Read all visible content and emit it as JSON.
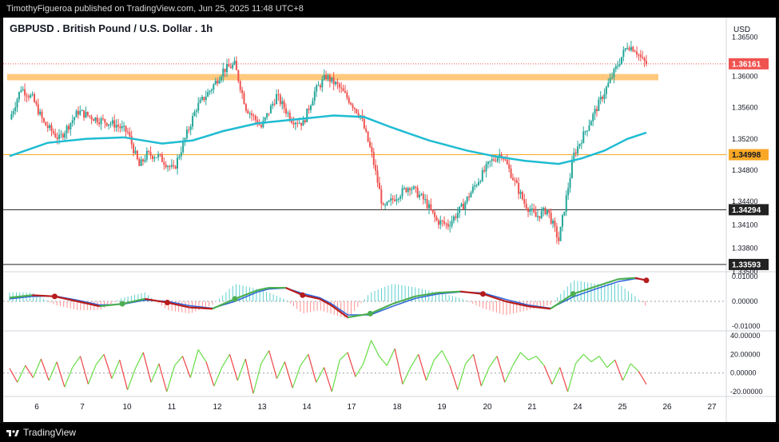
{
  "header": {
    "published": "TimothyFigueroa published on TradingView.com, Jun 25, 2025 11:48 UTC+8"
  },
  "footer": {
    "brand": "TradingView"
  },
  "colors": {
    "bull": "#26a69a",
    "bear": "#ef5350",
    "ma": "#1fbcd2",
    "zone": "#ffbf66",
    "support": "#f9a825",
    "level": "#222222",
    "osc_up": "#4caf50",
    "osc_dn": "#b71c1c",
    "osc_signal": "#2b63d9",
    "rsi_up": "#66dd44",
    "rsi_dn": "#ee4444"
  },
  "chart_data": [
    {
      "type": "candlestick",
      "title": "GBPUSD . British Pound / U.S. Dollar . 1h",
      "currency": "USD",
      "ylim": [
        1.335,
        1.3665
      ],
      "y_ticks": [
        "1.36500",
        "1.36000",
        "1.35600",
        "1.35200",
        "1.34800",
        "1.34400",
        "1.34100",
        "1.33800",
        "1.33500"
      ],
      "x_ticks": [
        "6",
        "7",
        "10",
        "11",
        "12",
        "13",
        "14",
        "17",
        "18",
        "19",
        "20",
        "21",
        "24",
        "25",
        "26",
        "27"
      ],
      "close_series": [
        [
          0,
          1.3545
        ],
        [
          6,
          1.3585
        ],
        [
          12,
          1.3572
        ],
        [
          18,
          1.354
        ],
        [
          26,
          1.352
        ],
        [
          36,
          1.3555
        ],
        [
          46,
          1.3545
        ],
        [
          56,
          1.3538
        ],
        [
          62,
          1.3528
        ],
        [
          68,
          1.3485
        ],
        [
          72,
          1.35
        ],
        [
          78,
          1.3498
        ],
        [
          86,
          1.348
        ],
        [
          92,
          1.352
        ],
        [
          98,
          1.356
        ],
        [
          106,
          1.3585
        ],
        [
          112,
          1.3608
        ],
        [
          118,
          1.3615
        ],
        [
          124,
          1.356
        ],
        [
          132,
          1.3535
        ],
        [
          140,
          1.3575
        ],
        [
          148,
          1.3545
        ],
        [
          154,
          1.354
        ],
        [
          160,
          1.358
        ],
        [
          166,
          1.36
        ],
        [
          172,
          1.3588
        ],
        [
          178,
          1.357
        ],
        [
          184,
          1.355
        ],
        [
          190,
          1.35
        ],
        [
          196,
          1.343
        ],
        [
          202,
          1.3445
        ],
        [
          210,
          1.346
        ],
        [
          218,
          1.344
        ],
        [
          224,
          1.3415
        ],
        [
          230,
          1.341
        ],
        [
          238,
          1.3435
        ],
        [
          244,
          1.346
        ],
        [
          252,
          1.349
        ],
        [
          258,
          1.3502
        ],
        [
          264,
          1.347
        ],
        [
          270,
          1.3438
        ],
        [
          276,
          1.342
        ],
        [
          282,
          1.343
        ],
        [
          288,
          1.339
        ],
        [
          292,
          1.3445
        ],
        [
          296,
          1.35
        ],
        [
          302,
          1.353
        ],
        [
          308,
          1.356
        ],
        [
          314,
          1.359
        ],
        [
          320,
          1.362
        ],
        [
          324,
          1.364
        ],
        [
          328,
          1.3635
        ],
        [
          332,
          1.362
        ],
        [
          334,
          1.3616
        ]
      ],
      "ema_series": [
        [
          0,
          1.3498
        ],
        [
          20,
          1.3515
        ],
        [
          40,
          1.352
        ],
        [
          60,
          1.3522
        ],
        [
          80,
          1.3514
        ],
        [
          96,
          1.3518
        ],
        [
          112,
          1.353
        ],
        [
          130,
          1.354
        ],
        [
          150,
          1.3545
        ],
        [
          170,
          1.355
        ],
        [
          186,
          1.3548
        ],
        [
          200,
          1.3535
        ],
        [
          220,
          1.3518
        ],
        [
          240,
          1.3505
        ],
        [
          254,
          1.3498
        ],
        [
          270,
          1.3492
        ],
        [
          288,
          1.3488
        ],
        [
          300,
          1.3495
        ],
        [
          312,
          1.3505
        ],
        [
          324,
          1.352
        ],
        [
          334,
          1.3528
        ]
      ],
      "resistance_zone": [
        1.3595,
        1.3603
      ],
      "horizontal_levels": [
        {
          "price": 1.34998,
          "label": "1.34998",
          "kind": "support"
        },
        {
          "price": 1.34294,
          "label": "1.34294",
          "kind": "level"
        },
        {
          "price": 1.33593,
          "label": "1.33593",
          "kind": "level"
        }
      ],
      "last_price": {
        "price": 1.36161,
        "label": "1.36161"
      }
    },
    {
      "type": "line",
      "name": "oscillator",
      "ylim": [
        -0.012,
        0.012
      ],
      "y_ticks": [
        "0.01000",
        "0.00000",
        "-0.01000"
      ],
      "main": [
        [
          0,
          0.0015
        ],
        [
          20,
          0.0025
        ],
        [
          40,
          0.002
        ],
        [
          60,
          0.0
        ],
        [
          80,
          -0.002
        ],
        [
          100,
          -0.001
        ],
        [
          120,
          0.001
        ],
        [
          140,
          -0.0005
        ],
        [
          160,
          -0.0025
        ],
        [
          180,
          -0.003
        ],
        [
          200,
          0.001
        ],
        [
          220,
          0.0045
        ],
        [
          230,
          0.0055
        ],
        [
          245,
          0.0055
        ],
        [
          260,
          0.0025
        ],
        [
          275,
          0.001
        ],
        [
          285,
          -0.0015
        ],
        [
          300,
          -0.0065
        ],
        [
          320,
          -0.005
        ],
        [
          340,
          -0.001
        ],
        [
          360,
          0.002
        ],
        [
          380,
          0.0035
        ],
        [
          400,
          0.004
        ],
        [
          420,
          0.003
        ],
        [
          440,
          0.0
        ],
        [
          460,
          -0.002
        ],
        [
          480,
          -0.003
        ],
        [
          500,
          0.003
        ],
        [
          520,
          0.006
        ],
        [
          540,
          0.009
        ],
        [
          555,
          0.0095
        ],
        [
          565,
          0.0085
        ]
      ],
      "signal": [
        [
          0,
          0.001
        ],
        [
          20,
          0.002
        ],
        [
          40,
          0.0022
        ],
        [
          60,
          0.0005
        ],
        [
          80,
          -0.0015
        ],
        [
          100,
          -0.0012
        ],
        [
          120,
          0.0005
        ],
        [
          140,
          0.0
        ],
        [
          160,
          -0.0018
        ],
        [
          180,
          -0.0028
        ],
        [
          200,
          0.0
        ],
        [
          220,
          0.0038
        ],
        [
          230,
          0.005
        ],
        [
          245,
          0.0054
        ],
        [
          260,
          0.0032
        ],
        [
          275,
          0.0015
        ],
        [
          285,
          -0.0008
        ],
        [
          300,
          -0.0055
        ],
        [
          320,
          -0.0055
        ],
        [
          340,
          -0.002
        ],
        [
          360,
          0.0012
        ],
        [
          380,
          0.003
        ],
        [
          400,
          0.0038
        ],
        [
          420,
          0.0034
        ],
        [
          440,
          0.0008
        ],
        [
          460,
          -0.0015
        ],
        [
          480,
          -0.0028
        ],
        [
          500,
          0.0018
        ],
        [
          520,
          0.005
        ],
        [
          540,
          0.008
        ],
        [
          555,
          0.0092
        ],
        [
          565,
          0.0088
        ]
      ]
    },
    {
      "type": "line",
      "name": "momentum",
      "ylim": [
        -25,
        45
      ],
      "y_ticks": [
        "40.00000",
        "20.00000",
        "0.00000",
        "-20.00000"
      ],
      "values": [
        [
          0,
          5
        ],
        [
          4,
          -10
        ],
        [
          8,
          8
        ],
        [
          12,
          -5
        ],
        [
          16,
          15
        ],
        [
          20,
          -8
        ],
        [
          24,
          12
        ],
        [
          28,
          -15
        ],
        [
          32,
          6
        ],
        [
          36,
          18
        ],
        [
          40,
          -12
        ],
        [
          44,
          9
        ],
        [
          48,
          20
        ],
        [
          52,
          -6
        ],
        [
          56,
          14
        ],
        [
          60,
          -18
        ],
        [
          64,
          5
        ],
        [
          68,
          22
        ],
        [
          72,
          -10
        ],
        [
          76,
          10
        ],
        [
          80,
          -20
        ],
        [
          84,
          8
        ],
        [
          88,
          18
        ],
        [
          92,
          -5
        ],
        [
          96,
          25
        ],
        [
          100,
          12
        ],
        [
          104,
          -14
        ],
        [
          108,
          6
        ],
        [
          112,
          20
        ],
        [
          116,
          -8
        ],
        [
          120,
          15
        ],
        [
          124,
          -22
        ],
        [
          128,
          10
        ],
        [
          132,
          24
        ],
        [
          136,
          -6
        ],
        [
          140,
          12
        ],
        [
          144,
          -16
        ],
        [
          148,
          8
        ],
        [
          152,
          20
        ],
        [
          156,
          -10
        ],
        [
          160,
          6
        ],
        [
          164,
          -20
        ],
        [
          168,
          14
        ],
        [
          172,
          22
        ],
        [
          176,
          -4
        ],
        [
          180,
          10
        ],
        [
          184,
          35
        ],
        [
          188,
          18
        ],
        [
          192,
          8
        ],
        [
          196,
          26
        ],
        [
          200,
          -12
        ],
        [
          204,
          6
        ],
        [
          208,
          20
        ],
        [
          212,
          -8
        ],
        [
          216,
          14
        ],
        [
          220,
          24
        ],
        [
          224,
          8
        ],
        [
          228,
          -18
        ],
        [
          232,
          10
        ],
        [
          236,
          20
        ],
        [
          240,
          -14
        ],
        [
          244,
          6
        ],
        [
          248,
          18
        ],
        [
          252,
          -10
        ],
        [
          256,
          8
        ],
        [
          260,
          22
        ],
        [
          264,
          14
        ],
        [
          268,
          18
        ],
        [
          272,
          8
        ],
        [
          276,
          -12
        ],
        [
          280,
          6
        ],
        [
          284,
          -20
        ],
        [
          288,
          10
        ],
        [
          292,
          20
        ],
        [
          296,
          12
        ],
        [
          300,
          18
        ],
        [
          304,
          6
        ],
        [
          308,
          14
        ],
        [
          312,
          -8
        ],
        [
          316,
          10
        ],
        [
          320,
          2
        ],
        [
          324,
          -12
        ]
      ]
    }
  ]
}
